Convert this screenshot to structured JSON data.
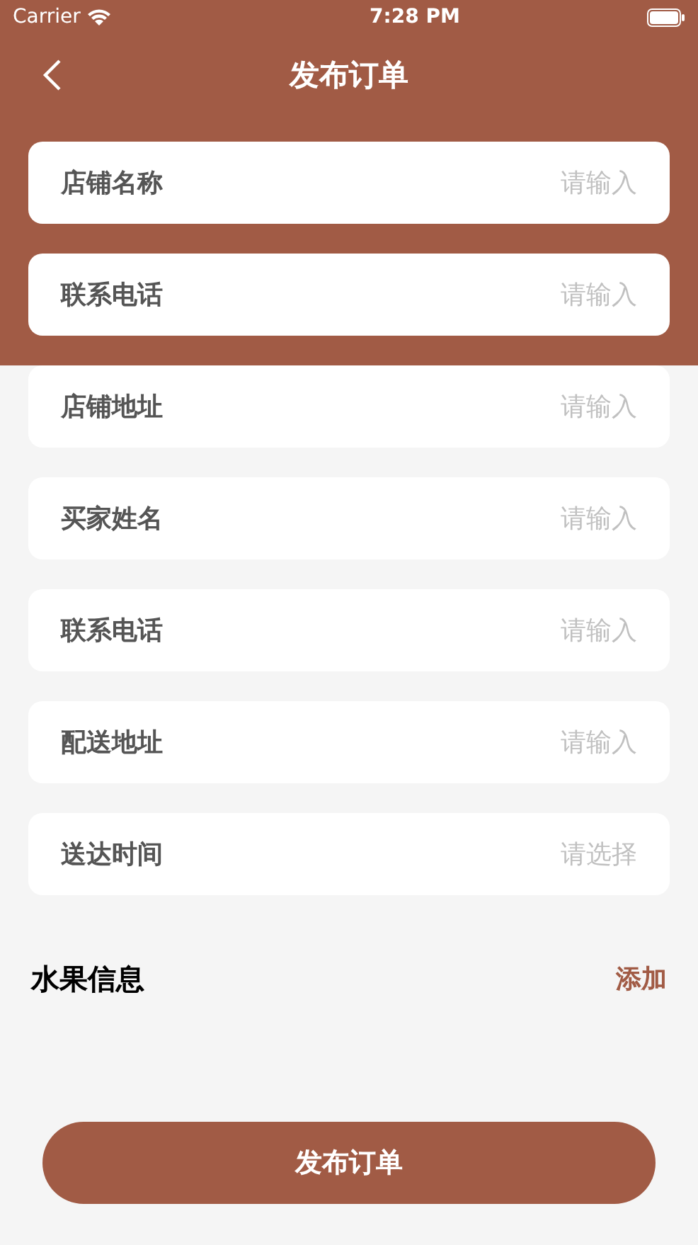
{
  "status_bar": {
    "carrier": "Carrier",
    "time": "7:28 PM"
  },
  "nav": {
    "title": "发布订单"
  },
  "fields": [
    {
      "label": "店铺名称",
      "placeholder": "请输入"
    },
    {
      "label": "联系电话",
      "placeholder": "请输入"
    },
    {
      "label": "店铺地址",
      "placeholder": "请输入"
    },
    {
      "label": "买家姓名",
      "placeholder": "请输入"
    },
    {
      "label": "联系电话",
      "placeholder": "请输入"
    },
    {
      "label": "配送地址",
      "placeholder": "请输入"
    },
    {
      "label": "送达时间",
      "placeholder": "请选择"
    }
  ],
  "fruit_section": {
    "title": "水果信息",
    "action": "添加"
  },
  "submit_button": "发布订单"
}
